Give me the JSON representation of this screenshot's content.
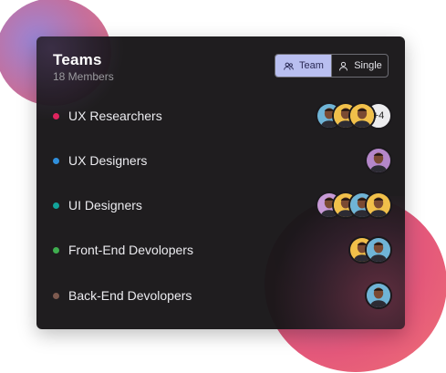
{
  "header": {
    "title": "Teams",
    "subtitle": "18 Members"
  },
  "toggle": {
    "team_label": "Team",
    "single_label": "Single",
    "selected": "Team"
  },
  "teams": [
    {
      "label": "UX Researchers",
      "dot_color": "#e0245e",
      "avatars": [
        "#6fb4d6",
        "#f1c04a",
        "#f1c04a"
      ],
      "more": "+4"
    },
    {
      "label": "UX Designers",
      "dot_color": "#2f8fdc",
      "avatars": [
        "#b487c9"
      ]
    },
    {
      "label": "UI Designers",
      "dot_color": "#12a39a",
      "avatars": [
        "#c79ad6",
        "#f1c04a",
        "#6fb4d6",
        "#f1c04a"
      ]
    },
    {
      "label": "Front-End Devolopers",
      "dot_color": "#3fae4f",
      "avatars": [
        "#f1c04a",
        "#6fb4d6"
      ]
    },
    {
      "label": "Back-End Devolopers",
      "dot_color": "#7d5a4f",
      "avatars": [
        "#6fb4d6"
      ]
    }
  ],
  "colors": {
    "card_bg": "#181618",
    "toggle_active_bg": "#b9bff0",
    "accent_gradient": "#e4587a"
  }
}
